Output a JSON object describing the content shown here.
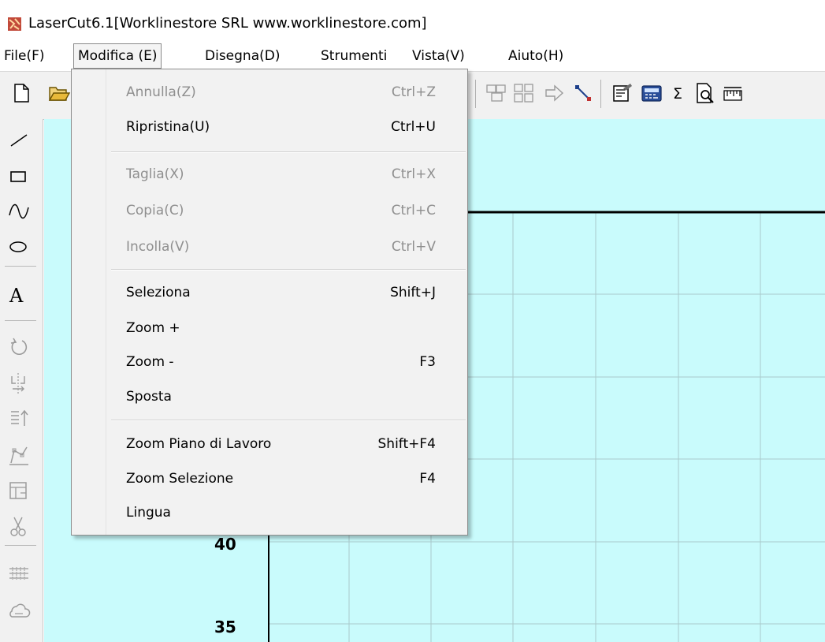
{
  "window": {
    "title": "LaserCut6.1[Worklinestore SRL www.worklinestore.com]"
  },
  "menubar": {
    "items": [
      {
        "label": "File(F)"
      },
      {
        "label": "Modifica (E)"
      },
      {
        "label": "Disegna(D)"
      },
      {
        "label": "Strumenti"
      },
      {
        "label": "Vista(V)"
      },
      {
        "label": "Aiuto(H)"
      }
    ]
  },
  "edit_menu": {
    "items": [
      {
        "label": "Annulla(Z)",
        "shortcut": "Ctrl+Z",
        "enabled": false
      },
      {
        "label": "Ripristina(U)",
        "shortcut": "Ctrl+U",
        "enabled": true
      },
      {
        "label": "Taglia(X)",
        "shortcut": "Ctrl+X",
        "enabled": false
      },
      {
        "label": "Copia(C)",
        "shortcut": "Ctrl+C",
        "enabled": false
      },
      {
        "label": "Incolla(V)",
        "shortcut": "Ctrl+V",
        "enabled": false
      },
      {
        "label": "Seleziona",
        "shortcut": "Shift+J",
        "enabled": true
      },
      {
        "label": "Zoom +",
        "shortcut": "",
        "enabled": true
      },
      {
        "label": "Zoom -",
        "shortcut": "F3",
        "enabled": true
      },
      {
        "label": "Sposta",
        "shortcut": "",
        "enabled": true
      },
      {
        "label": "Zoom Piano di Lavoro",
        "shortcut": "Shift+F4",
        "enabled": true
      },
      {
        "label": "Zoom Selezione",
        "shortcut": "F4",
        "enabled": true
      },
      {
        "label": "Lingua",
        "shortcut": "",
        "enabled": true
      }
    ]
  },
  "toolbar": {
    "icons": [
      "new-file-icon",
      "open-folder-icon",
      "group-icon",
      "ungroup-icon",
      "arrow-right-icon",
      "node-edit-icon",
      "properties-icon",
      "calculator-icon",
      "sigma-icon",
      "preview-icon",
      "ruler-icon"
    ]
  },
  "left_tools": {
    "icons": [
      "line-tool-icon",
      "rectangle-tool-icon",
      "curve-tool-icon",
      "ellipse-tool-icon",
      "text-tool-icon",
      "rotate-icon",
      "mirror-icon",
      "align-icon",
      "polyline-edit-icon",
      "frame-icon",
      "scissors-icon",
      "array-icon",
      "cloud-icon"
    ]
  },
  "canvas": {
    "ruler_labels": [
      "40",
      "35"
    ],
    "background": "#c9fbfc",
    "grid_color": "#a9c9cb"
  }
}
